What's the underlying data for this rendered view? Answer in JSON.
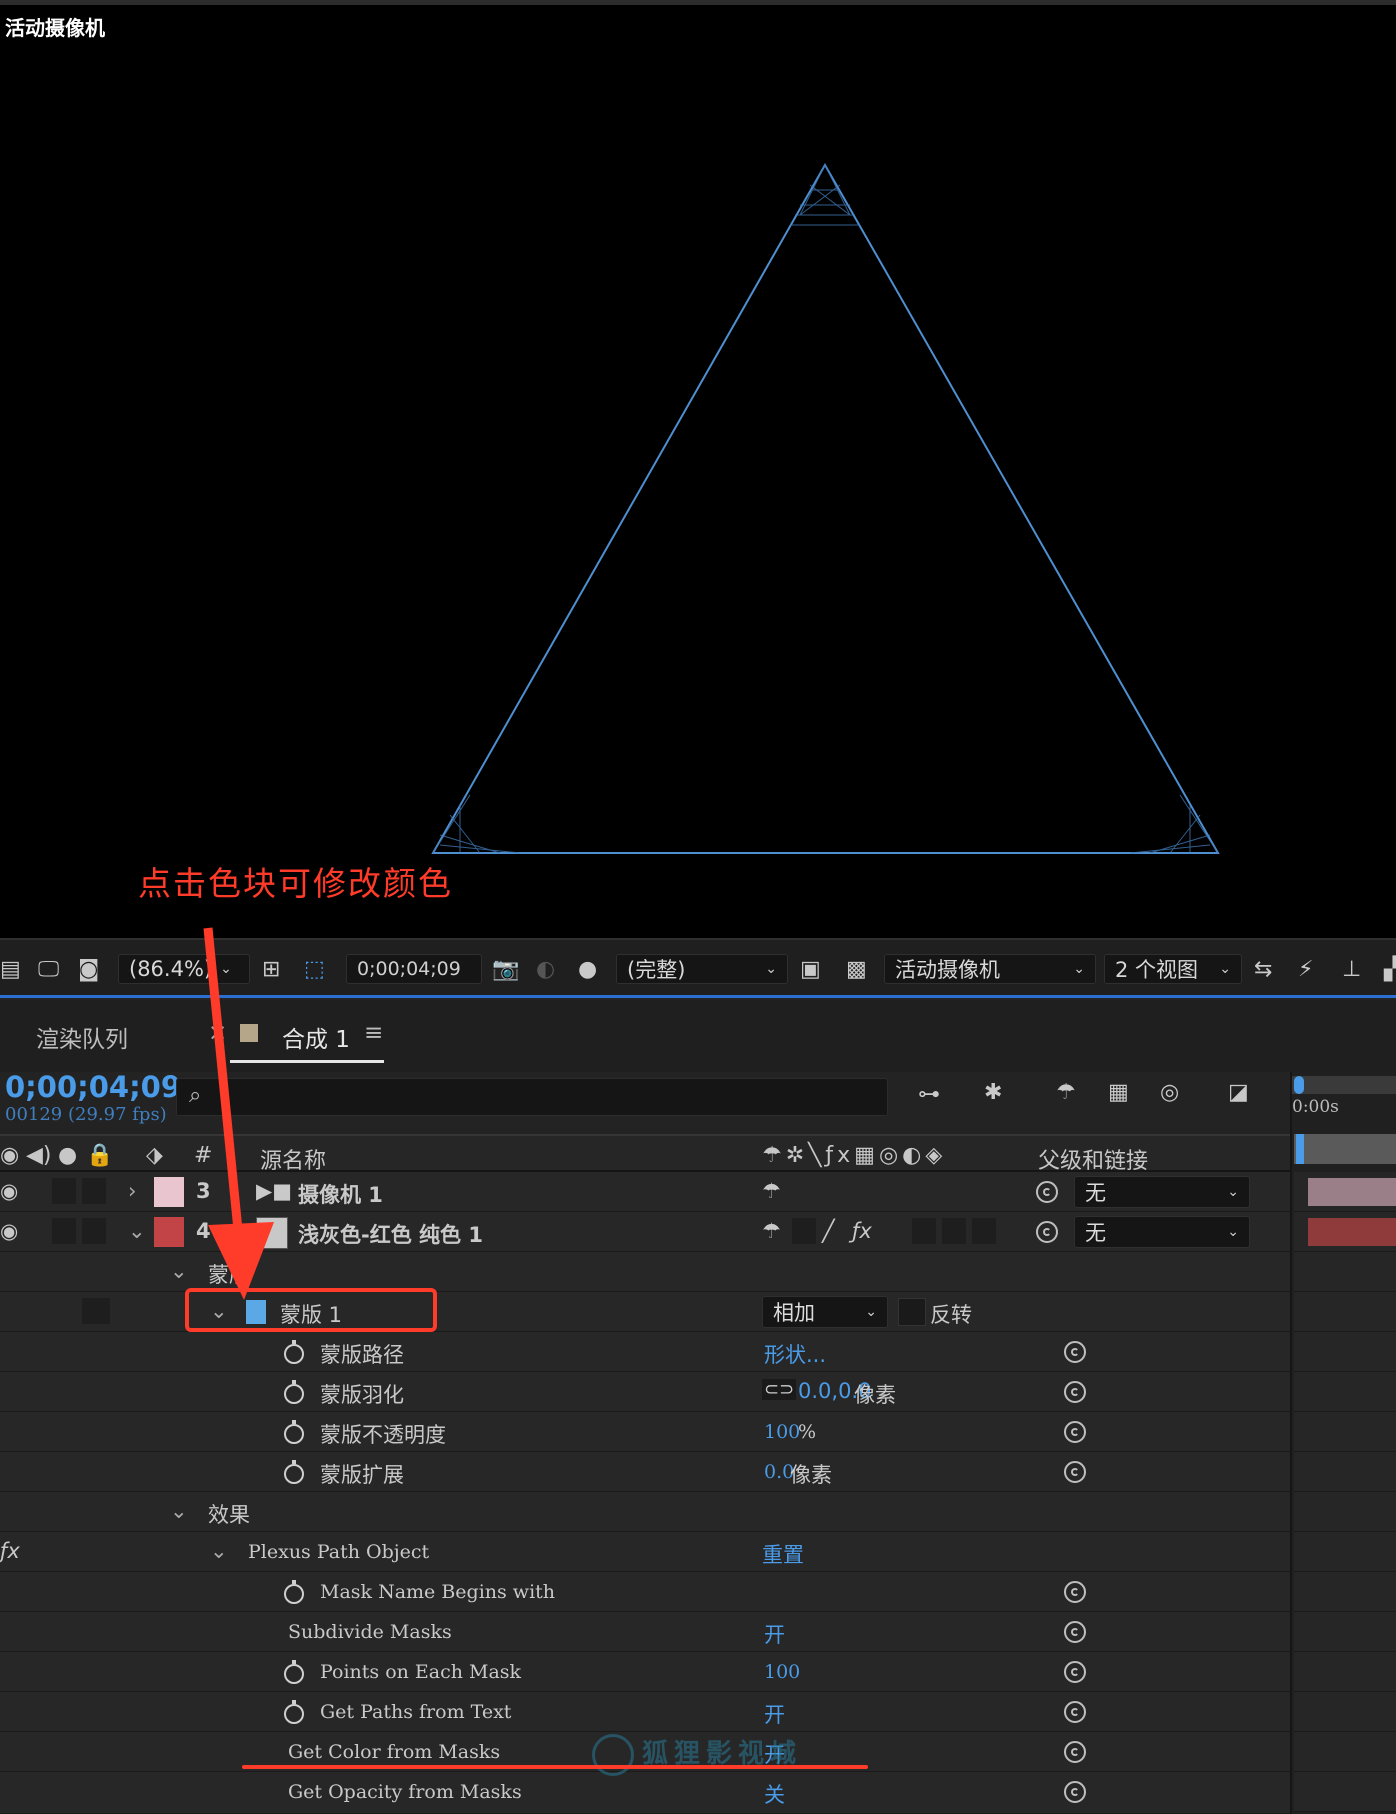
{
  "viewer": {
    "title": "活动摄像机"
  },
  "annotation": {
    "text": "点击色块可修改颜色"
  },
  "watermark": {
    "text": "狐狸影视城"
  },
  "toolbar": {
    "zoom": "(86.4%)",
    "timecode": "0;00;04;09",
    "quality": "(完整)",
    "camera": "活动摄像机",
    "views": "2 个视图"
  },
  "tabs": {
    "render_queue": "渲染队列",
    "comp": "合成 1",
    "comp_color": "#b5a68a"
  },
  "timeline": {
    "timecode": "0;00;04;09",
    "frames": "00129 (29.97 fps)",
    "search_placeholder": "",
    "ruler": "0:00s"
  },
  "columns": {
    "hash": "#",
    "source_name": "源名称",
    "parent": "父级和链接"
  },
  "layers": [
    {
      "num": "3",
      "name": "摄像机 1",
      "color": "#e8c5cf",
      "parent": "无"
    },
    {
      "num": "4",
      "name": "浅灰色-红色 纯色 1",
      "color": "#c24446",
      "parent": "无"
    }
  ],
  "masks_group": "蒙版",
  "mask1": {
    "name": "蒙版 1",
    "color": "#5aa8e6",
    "mode": "相加",
    "invert": "反转"
  },
  "mask_props": [
    {
      "label": "蒙版路径",
      "value": "形状...",
      "unit": ""
    },
    {
      "label": "蒙版羽化",
      "value": "0.0,0.0",
      "unit": " 像素"
    },
    {
      "label": "蒙版不透明度",
      "value": "100",
      "unit": "%"
    },
    {
      "label": "蒙版扩展",
      "value": "0.0",
      "unit": " 像素"
    }
  ],
  "effects_group": "效果",
  "effect": {
    "name": "Plexus Path Object",
    "reset": "重置"
  },
  "effect_props": [
    {
      "label": "Mask Name Begins with",
      "value": ""
    },
    {
      "label": "Subdivide Masks",
      "value": "开"
    },
    {
      "label": "Points on Each Mask",
      "value": "100"
    },
    {
      "label": "Get Paths from Text",
      "value": "开"
    },
    {
      "label": "Get Color from Masks",
      "value": "开"
    },
    {
      "label": "Get Opacity from Masks",
      "value": "关"
    }
  ],
  "colors": {
    "accent": "#4a9be8",
    "annotation": "#ff3b2a",
    "line": "#4f8fd0"
  }
}
